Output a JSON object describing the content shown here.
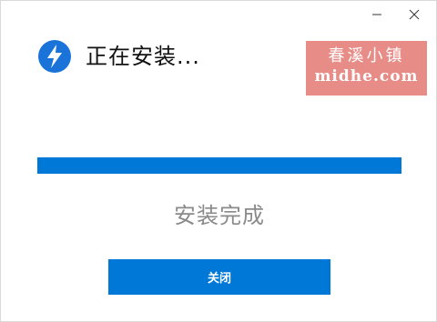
{
  "window": {
    "minimize_icon": "minimize-icon",
    "close_icon": "close-icon"
  },
  "header": {
    "logo_icon": "lightning-bolt-icon",
    "title": "正在安装..."
  },
  "watermark": {
    "line1": "春溪小镇",
    "line2": "midhe.com"
  },
  "progress": {
    "percent": 100
  },
  "status_text": "安装完成",
  "close_button_label": "关闭",
  "colors": {
    "accent": "#0078d7",
    "watermark_bg": "#e88c87",
    "status_text": "#8a8a8a"
  }
}
